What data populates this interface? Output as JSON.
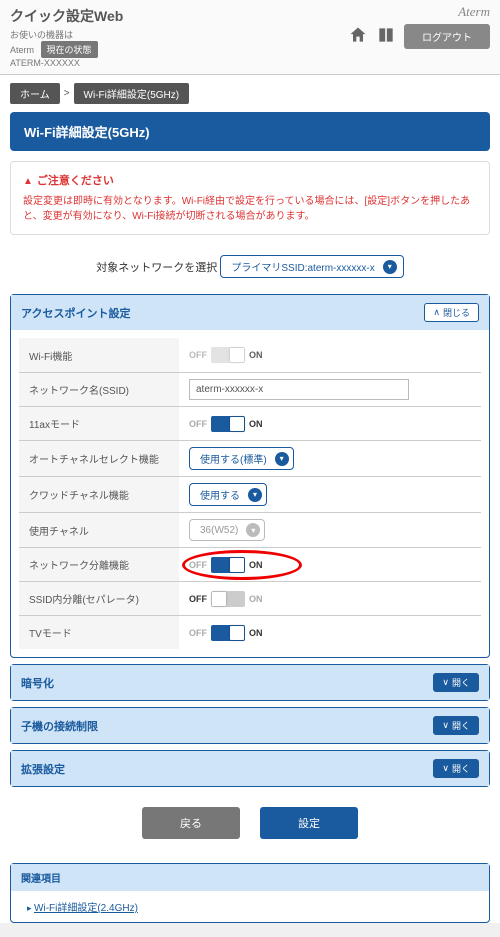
{
  "header": {
    "title": "クイック設定Web",
    "device_line": "お使いの機器は",
    "device_name": "Aterm",
    "device_model": "ATERM-XXXXXX",
    "status_btn": "現在の状態",
    "brand": "Aterm",
    "logout": "ログアウト"
  },
  "crumbs": {
    "home": "ホーム",
    "page": "Wi-Fi詳細設定(5GHz)"
  },
  "page_title": "Wi-Fi詳細設定(5GHz)",
  "notice": {
    "heading": "ご注意ください",
    "body": "設定変更は即時に有効となります。Wi-Fi経由で設定を行っている場合には、[設定]ボタンを押したあと、変更が有効になり、Wi-Fi接続が切断される場合があります。"
  },
  "netselect": {
    "label": "対象ネットワークを選択",
    "value": "プライマリSSID:aterm-xxxxxx-x"
  },
  "sections": {
    "ap": {
      "title": "アクセスポイント設定",
      "toggle": "閉じる",
      "rows": {
        "wifi": "Wi-Fi機能",
        "ssid": "ネットワーク名(SSID)",
        "ssid_value": "aterm-xxxxxx-x",
        "ax": "11axモード",
        "autoch": "オートチャネルセレクト機能",
        "autoch_value": "使用する(標準)",
        "quad": "クワッドチャネル機能",
        "quad_value": "使用する",
        "channel": "使用チャネル",
        "channel_value": "36(W52)",
        "isolate": "ネットワーク分離機能",
        "ssidsep": "SSID内分離(セパレータ)",
        "tv": "TVモード"
      }
    },
    "enc": {
      "title": "暗号化",
      "toggle": "開く"
    },
    "maclimit": {
      "title": "子機の接続制限",
      "toggle": "開く"
    },
    "ext": {
      "title": "拡張設定",
      "toggle": "開く"
    }
  },
  "labels": {
    "off": "OFF",
    "on": "ON"
  },
  "buttons": {
    "back": "戻る",
    "apply": "設定"
  },
  "related": {
    "title": "関連項目",
    "link1": "Wi-Fi詳細設定(2.4GHz)"
  }
}
